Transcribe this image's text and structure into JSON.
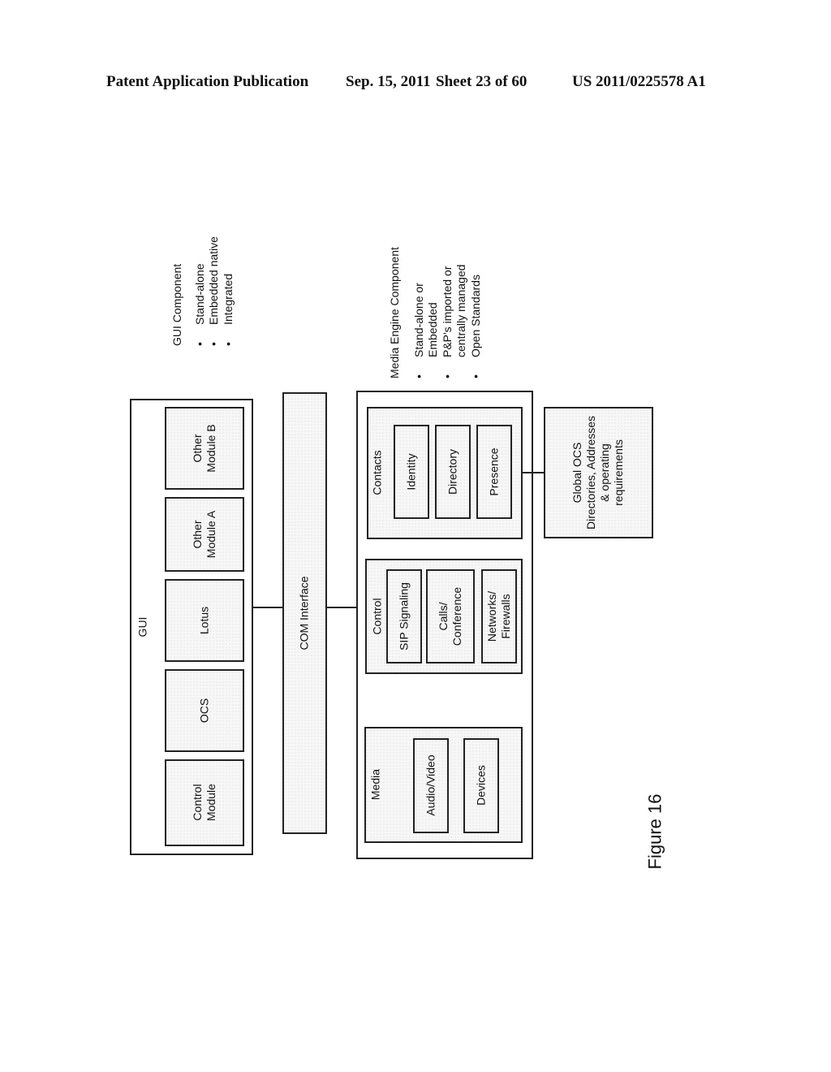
{
  "header": {
    "publication": "Patent Application Publication",
    "date": "Sep. 15, 2011",
    "sheet": "Sheet 23 of 60",
    "number": "US 2011/0225578 A1"
  },
  "gui_component": {
    "title": "GUI Component",
    "bullets": [
      "Stand-alone",
      "Embedded native",
      "Integrated"
    ]
  },
  "media_engine_component": {
    "title": "Media Engine Component",
    "bullets": [
      {
        "lines": [
          "Stand-alone or",
          "Embedded"
        ]
      },
      {
        "lines": [
          "P&P's imported or",
          "centrally managed"
        ]
      },
      {
        "lines": [
          "Open Standards"
        ]
      }
    ]
  },
  "gui_box": {
    "label": "GUI",
    "modules": [
      {
        "lines": [
          "Other",
          "Module B"
        ]
      },
      {
        "lines": [
          "Other",
          "Module A"
        ]
      },
      {
        "lines": [
          "Lotus"
        ]
      },
      {
        "lines": [
          "OCS"
        ]
      },
      {
        "lines": [
          "Control",
          "Module"
        ]
      }
    ]
  },
  "com_interface": {
    "label": "COM Interface"
  },
  "media_engine_box": {
    "groups": {
      "contacts": {
        "label": "Contacts",
        "items": [
          "Identity",
          "Directory",
          "Presence"
        ]
      },
      "control": {
        "label": "Control",
        "items": [
          "SIP Signaling",
          "Calls/\nConference",
          "Networks/\nFirewalls"
        ]
      },
      "media": {
        "label": "Media",
        "items": [
          "Audio/Video",
          "Devices"
        ]
      }
    }
  },
  "global_ocs": {
    "lines": [
      "Global OCS",
      "Directories, Addresses",
      "& operating",
      "requirements"
    ]
  },
  "figure_label": "Figure 16"
}
